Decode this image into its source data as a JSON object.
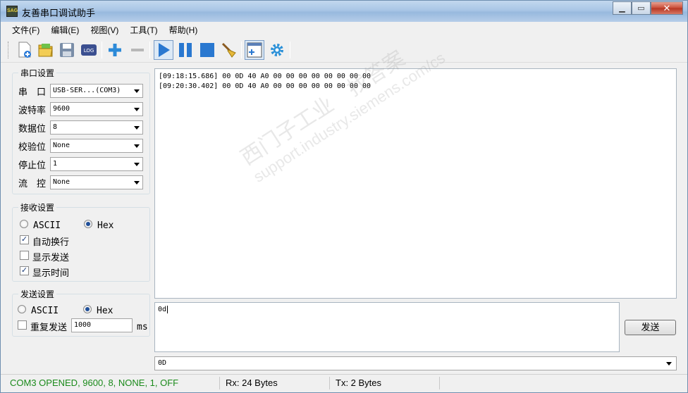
{
  "window": {
    "title": "友善串口调试助手",
    "app_icon": "serial-app-icon",
    "icon_text": "SAG"
  },
  "menu": [
    "文件(F)",
    "编辑(E)",
    "视图(V)",
    "工具(T)",
    "帮助(H)"
  ],
  "toolbar": {
    "icons": [
      "new-file-icon",
      "open-folder-icon",
      "save-icon",
      "log-icon",
      "add-icon",
      "remove-icon",
      "play-icon",
      "pause-icon",
      "stop-icon",
      "clear-broom-icon",
      "layout-icon",
      "settings-gear-icon"
    ],
    "log_label": "LOG"
  },
  "serial_settings": {
    "title": "串口设置",
    "port_label": "串　口",
    "port_value": "USB-SER...(COM3)",
    "baud_label": "波特率",
    "baud_value": "9600",
    "databits_label": "数据位",
    "databits_value": "8",
    "parity_label": "校验位",
    "parity_value": "None",
    "stopbits_label": "停止位",
    "stopbits_value": "1",
    "flow_label": "流　控",
    "flow_value": "None"
  },
  "receive_settings": {
    "title": "接收设置",
    "ascii_label": "ASCII",
    "hex_label": "Hex",
    "mode": "Hex",
    "auto_newline_label": "自动换行",
    "auto_newline": true,
    "show_send_label": "显示发送",
    "show_send": false,
    "show_time_label": "显示时间",
    "show_time": true
  },
  "send_settings": {
    "title": "发送设置",
    "ascii_label": "ASCII",
    "hex_label": "Hex",
    "mode": "Hex",
    "repeat_label": "重复发送",
    "repeat": false,
    "interval_value": "1000",
    "interval_unit": "ms"
  },
  "receive_log": [
    "[09:18:15.686] 00 0D 40 A0 00 00 00 00 00 00 00 00",
    "[09:20:30.402] 00 0D 40 A0 00 00 00 00 00 00 00 00"
  ],
  "watermark": {
    "line1": "西门子工业　找答案",
    "line2": "support.industry.siemens.com/cs"
  },
  "send_input": {
    "value": "0d"
  },
  "send_button": "发送",
  "history": {
    "value": "0D"
  },
  "status": {
    "port": "COM3 OPENED, 9600, 8, NONE, 1, OFF",
    "rx": "Rx: 24 Bytes",
    "tx": "Tx: 2 Bytes",
    "port_color": "#1a8a1a"
  }
}
